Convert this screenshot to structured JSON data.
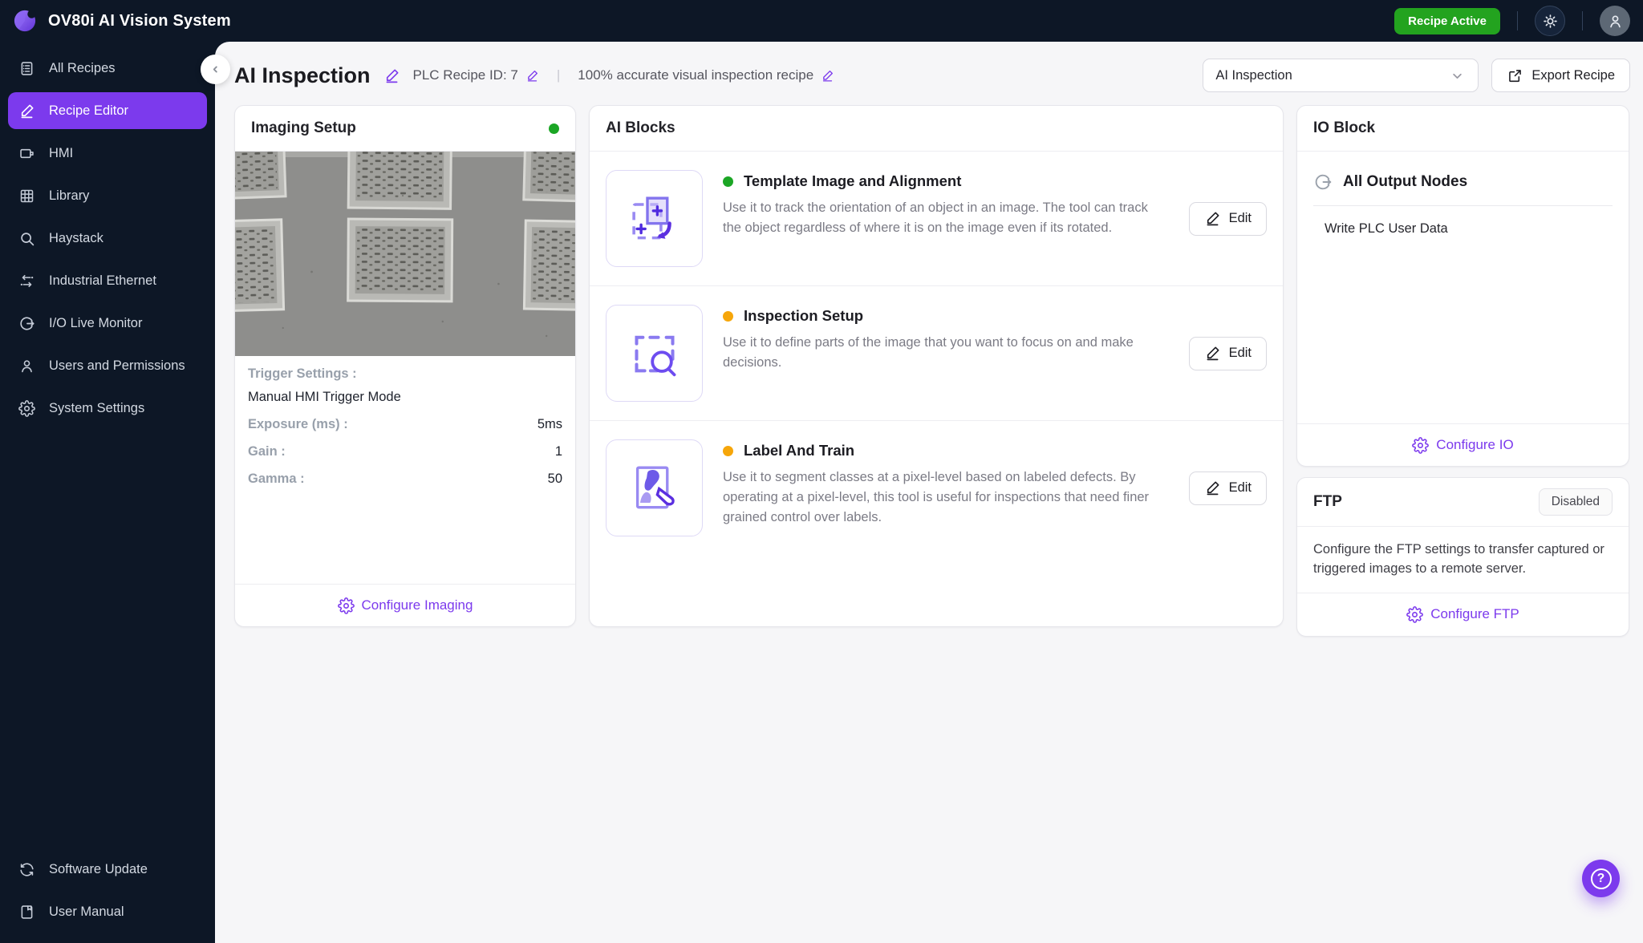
{
  "colors": {
    "accent_purple": "#7C3AED",
    "navy_background": "#0D1726",
    "recipe_active_green": "#23A31F",
    "status_green": "#1BA625",
    "status_amber": "#F6A60A"
  },
  "topbar": {
    "app_title": "OV80i AI Vision System",
    "recipe_status": "Recipe Active",
    "icons": {
      "logo": "logo-mark",
      "theme": "sun-icon",
      "account": "user-avatar-icon"
    }
  },
  "sidebar": {
    "items": [
      {
        "label": "All Recipes",
        "icon": "recipes-list-icon",
        "active": false
      },
      {
        "label": "Recipe Editor",
        "icon": "pencil-icon",
        "active": true
      },
      {
        "label": "HMI",
        "icon": "hmi-monitor-icon",
        "active": false
      },
      {
        "label": "Library",
        "icon": "grid-icon",
        "active": false
      },
      {
        "label": "Haystack",
        "icon": "search-icon",
        "active": false
      },
      {
        "label": "Industrial Ethernet",
        "icon": "swap-arrows-icon",
        "active": false
      },
      {
        "label": "I/O Live Monitor",
        "icon": "circle-arrow-icon",
        "active": false
      },
      {
        "label": "Users and Permissions",
        "icon": "user-icon",
        "active": false
      },
      {
        "label": "System Settings",
        "icon": "gear-icon",
        "active": false
      }
    ],
    "footer_items": [
      {
        "label": "Software Update",
        "icon": "refresh-icon"
      },
      {
        "label": "User Manual",
        "icon": "manual-book-icon"
      }
    ]
  },
  "header": {
    "title": "AI Inspection",
    "plc_recipe_id": "PLC Recipe ID: 7",
    "separator": "|",
    "description": "100% accurate visual inspection recipe",
    "recipe_select_value": "AI Inspection",
    "export_button": "Export Recipe"
  },
  "imaging_setup": {
    "title": "Imaging Setup",
    "status": "green",
    "trigger_label": "Trigger Settings :",
    "trigger_value": "Manual HMI Trigger Mode",
    "rows": [
      {
        "label": "Exposure (ms) :",
        "value": "5ms"
      },
      {
        "label": "Gain :",
        "value": "1"
      },
      {
        "label": "Gamma :",
        "value": "50"
      }
    ],
    "footer_link": "Configure Imaging"
  },
  "ai_blocks": {
    "title": "AI Blocks",
    "edit_button": "Edit",
    "blocks": [
      {
        "title": "Template Image and Alignment",
        "status": "green",
        "description": "Use it to track the orientation of an object in an image. The tool can track the object regardless of where it is on the image even if its rotated."
      },
      {
        "title": "Inspection Setup",
        "status": "amber",
        "description": "Use it to define parts of the image that you want to focus on and make decisions."
      },
      {
        "title": "Label And Train",
        "status": "amber",
        "description": "Use it to segment classes at a pixel-level based on labeled defects. By operating at a pixel-level, this tool is useful for inspections that need finer grained control over labels."
      }
    ]
  },
  "io_block": {
    "title": "IO Block",
    "section_title": "All Output Nodes",
    "nodes": [
      "Write PLC User Data"
    ],
    "footer_link": "Configure IO"
  },
  "ftp": {
    "title": "FTP",
    "status_badge": "Disabled",
    "description": "Configure the FTP settings to transfer captured or triggered images to a remote server.",
    "footer_link": "Configure FTP"
  },
  "help": {
    "label": "?"
  }
}
